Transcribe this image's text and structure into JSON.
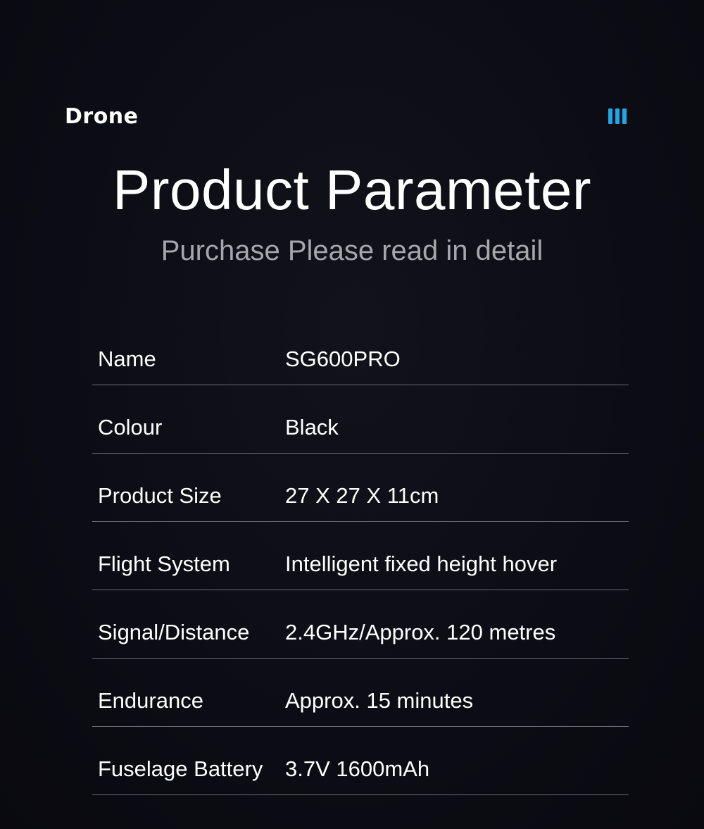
{
  "header": {
    "brand": "Drone",
    "accent_color": "#1ea8e6",
    "menu_icon": "three-bars-icon"
  },
  "hero": {
    "title": "Product Parameter",
    "subtitle": "Purchase Please read in detail"
  },
  "specs": [
    {
      "label": "Name",
      "value": "SG600PRO"
    },
    {
      "label": "Colour",
      "value": "Black"
    },
    {
      "label": "Product Size",
      "value": "27 X 27 X 11cm"
    },
    {
      "label": "Flight System",
      "value": "Intelligent fixed height hover"
    },
    {
      "label": "Signal/Distance",
      "value": "2.4GHz/Approx. 120 metres"
    },
    {
      "label": "Endurance",
      "value": "Approx. 15 minutes"
    },
    {
      "label": "Fuselage Battery",
      "value": "3.7V 1600mAh"
    }
  ]
}
